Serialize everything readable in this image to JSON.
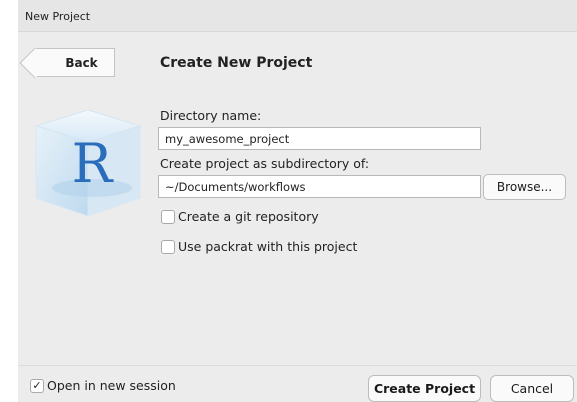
{
  "window": {
    "title": "New Project"
  },
  "header": {
    "back_label": "Back",
    "title": "Create New Project"
  },
  "logo": {
    "letter": "R"
  },
  "form": {
    "directory_label": "Directory name:",
    "directory_value": "my_awesome_project",
    "parent_label": "Create project as subdirectory of:",
    "parent_value": "~/Documents/workflows",
    "browse_label": "Browse...",
    "git_label": "Create a git repository",
    "git_checked": false,
    "packrat_label": "Use packrat with this project",
    "packrat_checked": false
  },
  "footer": {
    "open_session_label": "Open in new session",
    "open_session_checked": true,
    "create_label": "Create Project",
    "cancel_label": "Cancel"
  },
  "colors": {
    "logo_blue": "#2a6ebb",
    "logo_cube": "#cfe4f4"
  }
}
